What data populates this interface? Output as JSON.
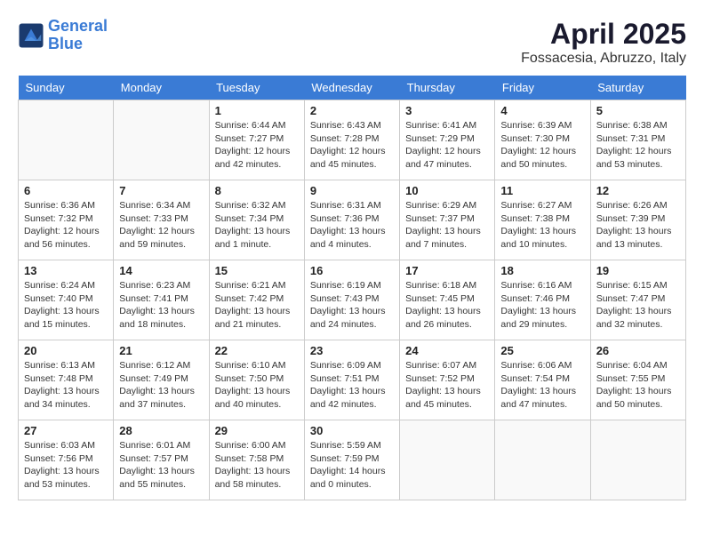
{
  "header": {
    "logo_line1": "General",
    "logo_line2": "Blue",
    "month_title": "April 2025",
    "location": "Fossacesia, Abruzzo, Italy"
  },
  "weekdays": [
    "Sunday",
    "Monday",
    "Tuesday",
    "Wednesday",
    "Thursday",
    "Friday",
    "Saturday"
  ],
  "weeks": [
    [
      {
        "day": "",
        "info": ""
      },
      {
        "day": "",
        "info": ""
      },
      {
        "day": "1",
        "info": "Sunrise: 6:44 AM\nSunset: 7:27 PM\nDaylight: 12 hours\nand 42 minutes."
      },
      {
        "day": "2",
        "info": "Sunrise: 6:43 AM\nSunset: 7:28 PM\nDaylight: 12 hours\nand 45 minutes."
      },
      {
        "day": "3",
        "info": "Sunrise: 6:41 AM\nSunset: 7:29 PM\nDaylight: 12 hours\nand 47 minutes."
      },
      {
        "day": "4",
        "info": "Sunrise: 6:39 AM\nSunset: 7:30 PM\nDaylight: 12 hours\nand 50 minutes."
      },
      {
        "day": "5",
        "info": "Sunrise: 6:38 AM\nSunset: 7:31 PM\nDaylight: 12 hours\nand 53 minutes."
      }
    ],
    [
      {
        "day": "6",
        "info": "Sunrise: 6:36 AM\nSunset: 7:32 PM\nDaylight: 12 hours\nand 56 minutes."
      },
      {
        "day": "7",
        "info": "Sunrise: 6:34 AM\nSunset: 7:33 PM\nDaylight: 12 hours\nand 59 minutes."
      },
      {
        "day": "8",
        "info": "Sunrise: 6:32 AM\nSunset: 7:34 PM\nDaylight: 13 hours\nand 1 minute."
      },
      {
        "day": "9",
        "info": "Sunrise: 6:31 AM\nSunset: 7:36 PM\nDaylight: 13 hours\nand 4 minutes."
      },
      {
        "day": "10",
        "info": "Sunrise: 6:29 AM\nSunset: 7:37 PM\nDaylight: 13 hours\nand 7 minutes."
      },
      {
        "day": "11",
        "info": "Sunrise: 6:27 AM\nSunset: 7:38 PM\nDaylight: 13 hours\nand 10 minutes."
      },
      {
        "day": "12",
        "info": "Sunrise: 6:26 AM\nSunset: 7:39 PM\nDaylight: 13 hours\nand 13 minutes."
      }
    ],
    [
      {
        "day": "13",
        "info": "Sunrise: 6:24 AM\nSunset: 7:40 PM\nDaylight: 13 hours\nand 15 minutes."
      },
      {
        "day": "14",
        "info": "Sunrise: 6:23 AM\nSunset: 7:41 PM\nDaylight: 13 hours\nand 18 minutes."
      },
      {
        "day": "15",
        "info": "Sunrise: 6:21 AM\nSunset: 7:42 PM\nDaylight: 13 hours\nand 21 minutes."
      },
      {
        "day": "16",
        "info": "Sunrise: 6:19 AM\nSunset: 7:43 PM\nDaylight: 13 hours\nand 24 minutes."
      },
      {
        "day": "17",
        "info": "Sunrise: 6:18 AM\nSunset: 7:45 PM\nDaylight: 13 hours\nand 26 minutes."
      },
      {
        "day": "18",
        "info": "Sunrise: 6:16 AM\nSunset: 7:46 PM\nDaylight: 13 hours\nand 29 minutes."
      },
      {
        "day": "19",
        "info": "Sunrise: 6:15 AM\nSunset: 7:47 PM\nDaylight: 13 hours\nand 32 minutes."
      }
    ],
    [
      {
        "day": "20",
        "info": "Sunrise: 6:13 AM\nSunset: 7:48 PM\nDaylight: 13 hours\nand 34 minutes."
      },
      {
        "day": "21",
        "info": "Sunrise: 6:12 AM\nSunset: 7:49 PM\nDaylight: 13 hours\nand 37 minutes."
      },
      {
        "day": "22",
        "info": "Sunrise: 6:10 AM\nSunset: 7:50 PM\nDaylight: 13 hours\nand 40 minutes."
      },
      {
        "day": "23",
        "info": "Sunrise: 6:09 AM\nSunset: 7:51 PM\nDaylight: 13 hours\nand 42 minutes."
      },
      {
        "day": "24",
        "info": "Sunrise: 6:07 AM\nSunset: 7:52 PM\nDaylight: 13 hours\nand 45 minutes."
      },
      {
        "day": "25",
        "info": "Sunrise: 6:06 AM\nSunset: 7:54 PM\nDaylight: 13 hours\nand 47 minutes."
      },
      {
        "day": "26",
        "info": "Sunrise: 6:04 AM\nSunset: 7:55 PM\nDaylight: 13 hours\nand 50 minutes."
      }
    ],
    [
      {
        "day": "27",
        "info": "Sunrise: 6:03 AM\nSunset: 7:56 PM\nDaylight: 13 hours\nand 53 minutes."
      },
      {
        "day": "28",
        "info": "Sunrise: 6:01 AM\nSunset: 7:57 PM\nDaylight: 13 hours\nand 55 minutes."
      },
      {
        "day": "29",
        "info": "Sunrise: 6:00 AM\nSunset: 7:58 PM\nDaylight: 13 hours\nand 58 minutes."
      },
      {
        "day": "30",
        "info": "Sunrise: 5:59 AM\nSunset: 7:59 PM\nDaylight: 14 hours\nand 0 minutes."
      },
      {
        "day": "",
        "info": ""
      },
      {
        "day": "",
        "info": ""
      },
      {
        "day": "",
        "info": ""
      }
    ]
  ]
}
